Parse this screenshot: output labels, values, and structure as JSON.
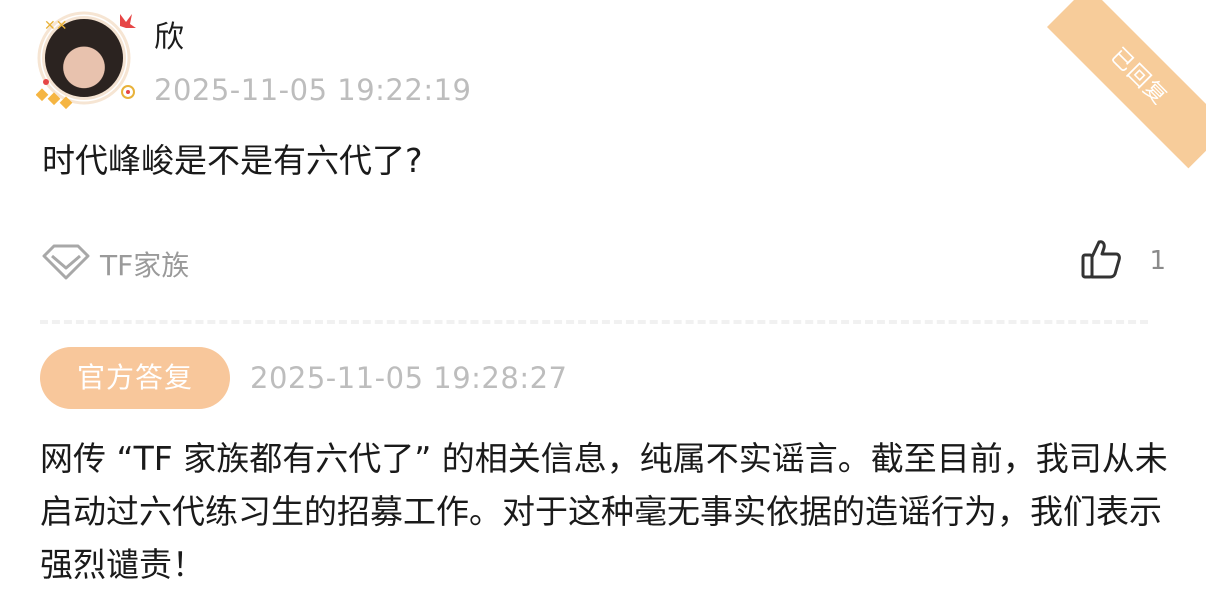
{
  "post": {
    "username": "欣",
    "timestamp": "2025-11-05 19:22:19",
    "question": "时代峰峻是不是有六代了?",
    "replied_ribbon": "已回复",
    "tag": {
      "icon": "diamond-icon",
      "label": "TF家族"
    },
    "like": {
      "icon": "thumbs-up-icon",
      "count": "1"
    }
  },
  "reply": {
    "badge": "官方答复",
    "timestamp": "2025-11-05 19:28:27",
    "body": "网传 “TF 家族都有六代了” 的相关信息，纯属不实谣言。截至目前，我司从未启动过六代练习生的招募工作。对于这种毫无事实依据的造谣行为，我们表示强烈谴责！"
  },
  "colors": {
    "accent": "#f8c79b",
    "muted_text": "#bdbdbd",
    "tag_text": "#9a9a9a"
  }
}
